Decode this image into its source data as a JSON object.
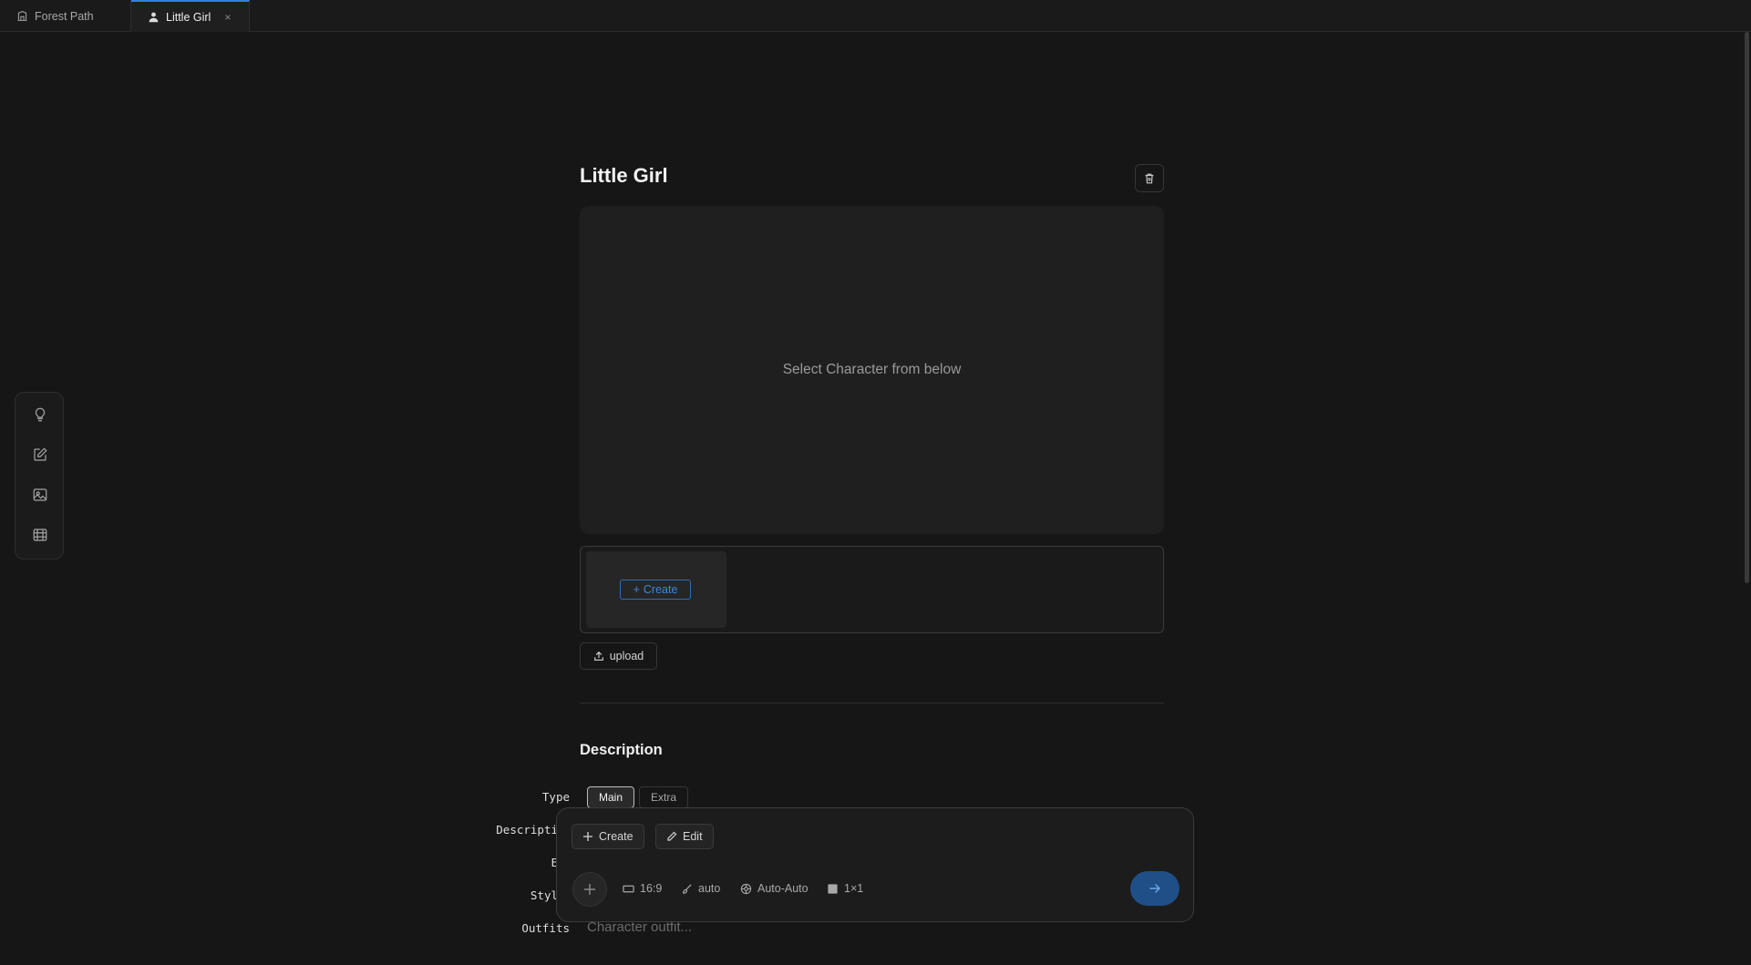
{
  "tabs": [
    {
      "label": "Forest Path",
      "icon": "building-icon"
    },
    {
      "label": "Little Girl",
      "icon": "user-icon",
      "active": true,
      "close": "×"
    }
  ],
  "rail": [
    "lightbulb-icon",
    "edit-icon",
    "image-icon",
    "film-icon"
  ],
  "page": {
    "title": "Little Girl",
    "preview_text": "Select Character from below",
    "create_label": "Create",
    "upload_label": "upload"
  },
  "description": {
    "section_title": "Description",
    "labels": {
      "type": "Type",
      "description": "Descripti",
      "e": "E",
      "style": "Styl",
      "outfits": "Outfits"
    },
    "type_options": [
      "Main",
      "Extra"
    ],
    "type_selected": "Main",
    "outfits_placeholder": "Character outfit..."
  },
  "composer": {
    "create_label": "Create",
    "edit_label": "Edit",
    "aspect": "16:9",
    "brush": "auto",
    "model": "Auto-Auto",
    "grid": "1×1"
  },
  "colors": {
    "accent": "#2f7fe8",
    "send_bg": "#1f4f86",
    "background": "#161616"
  }
}
